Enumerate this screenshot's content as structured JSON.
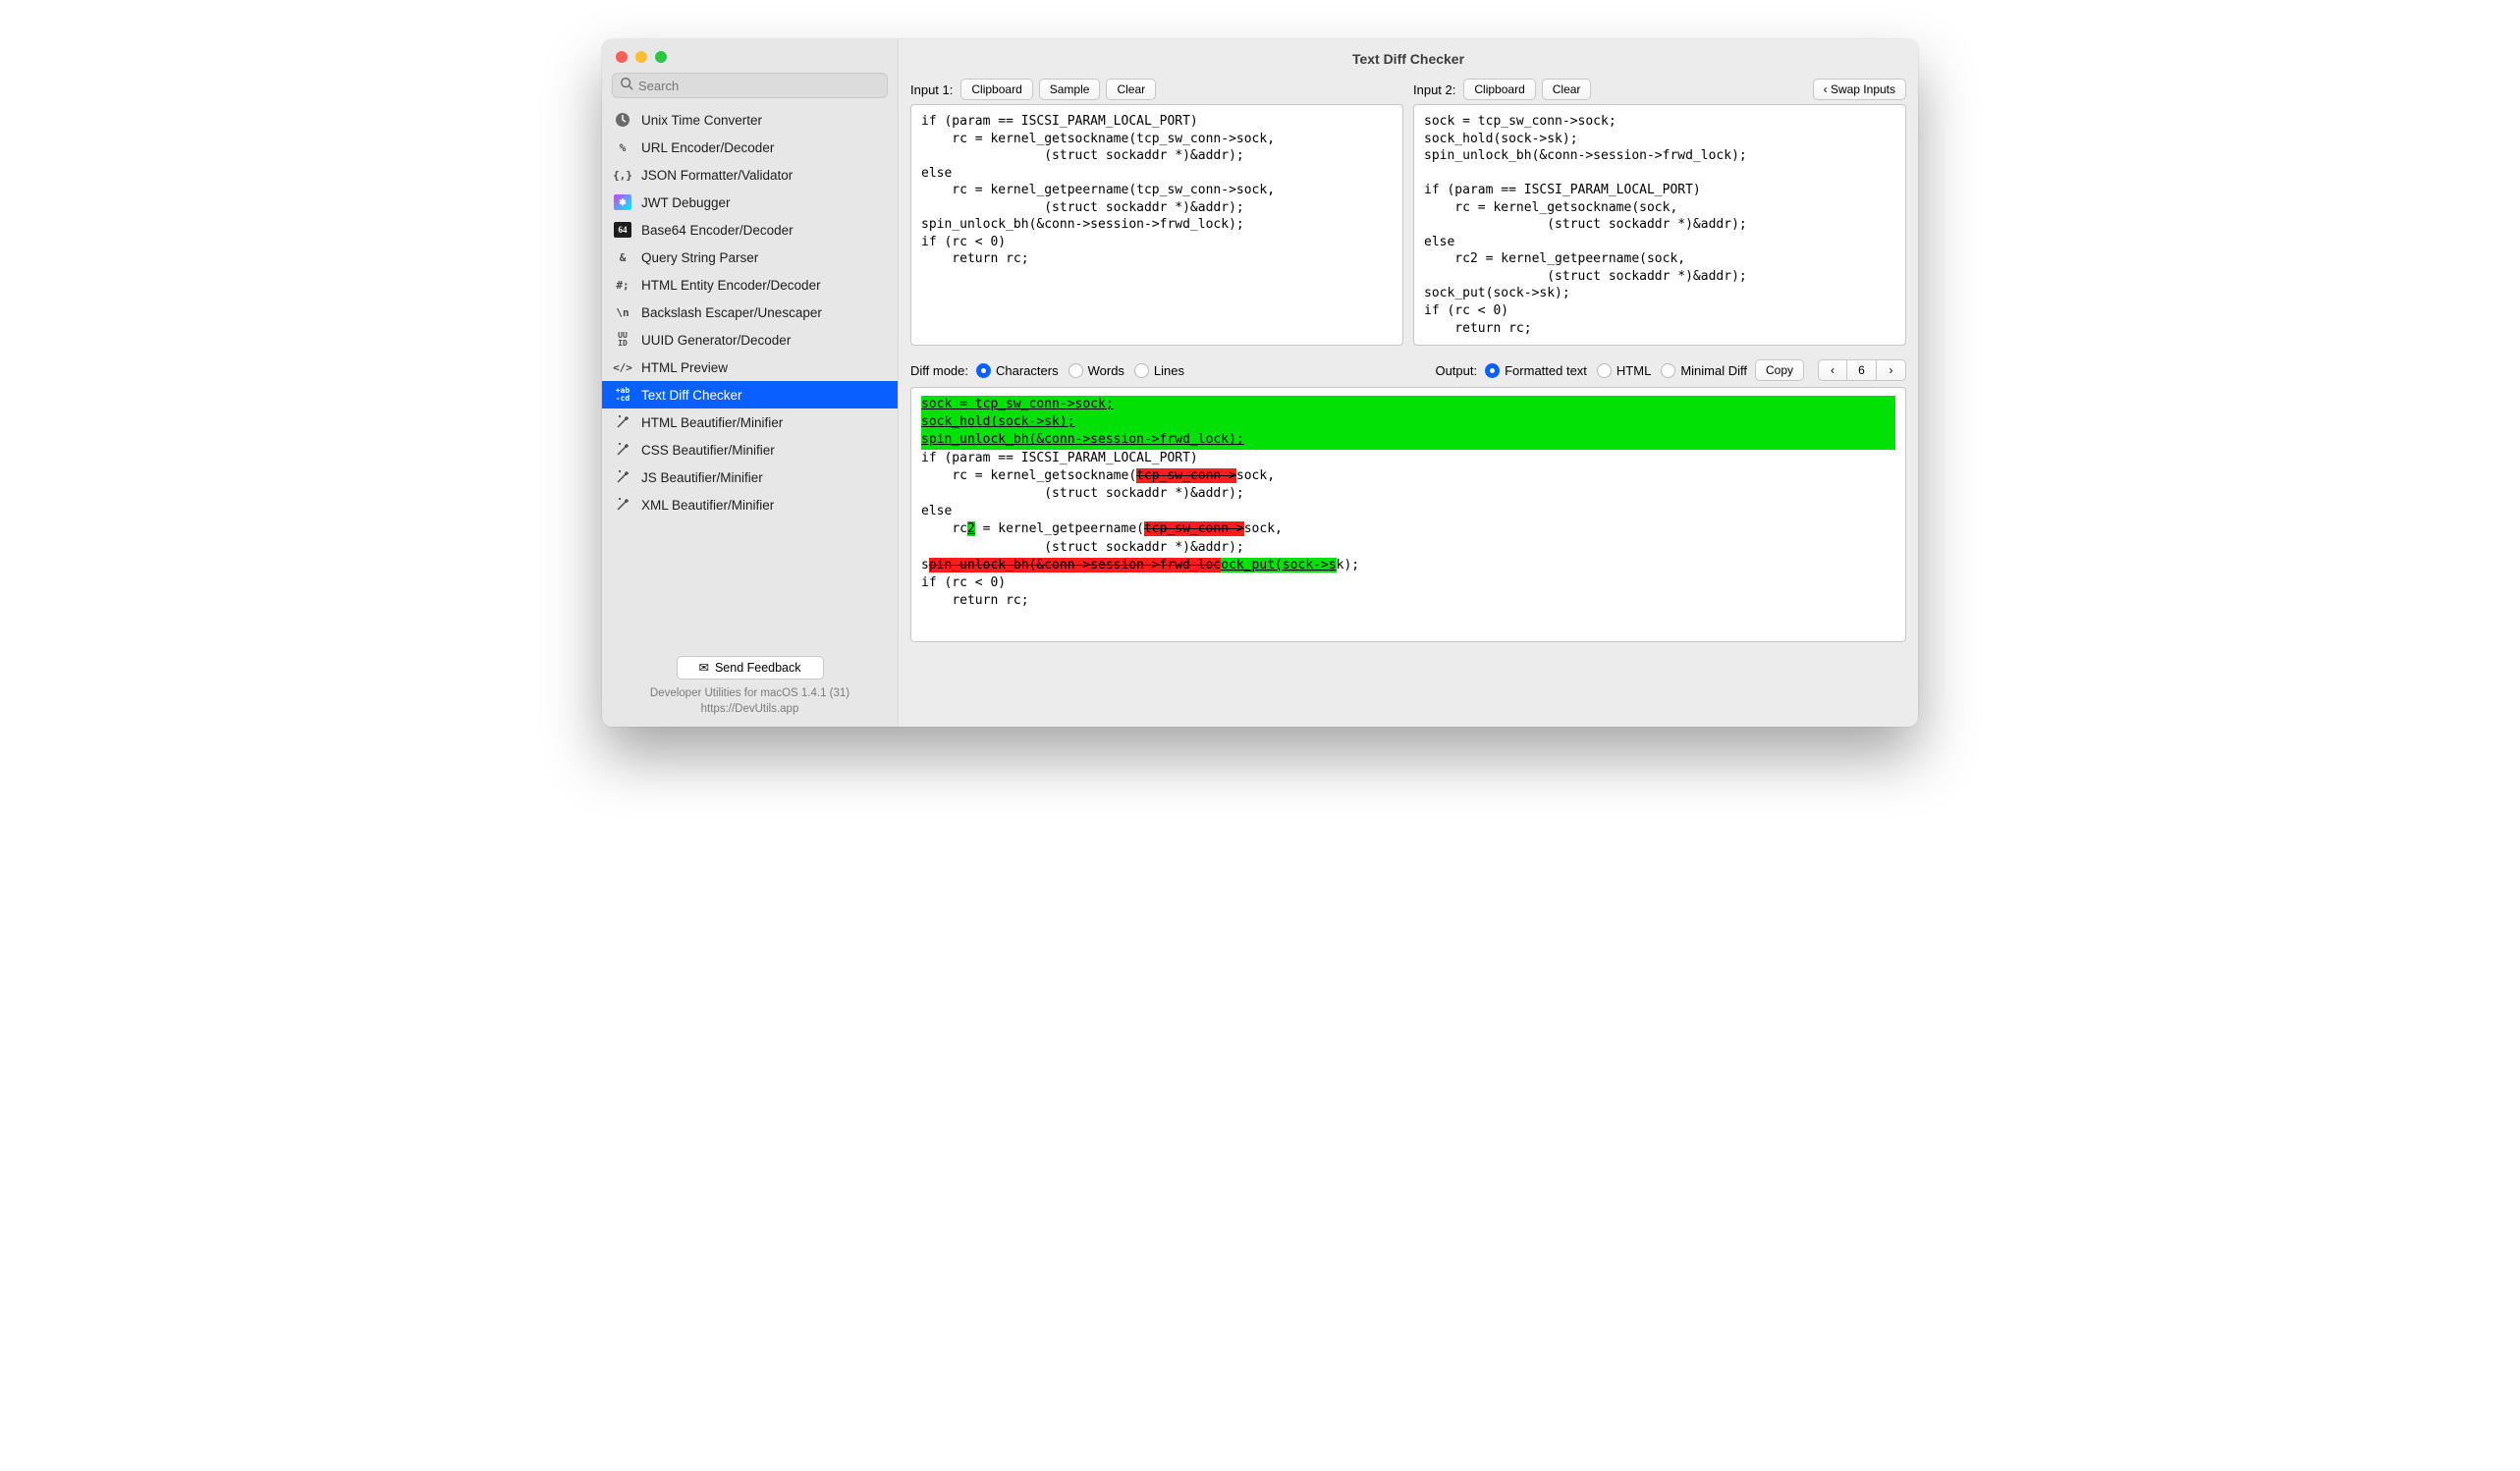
{
  "search": {
    "placeholder": "Search"
  },
  "sidebar": {
    "items": [
      {
        "icon": "clock",
        "label": "Unix Time Converter"
      },
      {
        "icon": "percent",
        "label": "URL Encoder/Decoder"
      },
      {
        "icon": "braces",
        "label": "JSON Formatter/Validator"
      },
      {
        "icon": "jwt",
        "label": "JWT Debugger"
      },
      {
        "icon": "b64",
        "label": "Base64 Encoder/Decoder"
      },
      {
        "icon": "amp",
        "label": "Query String Parser"
      },
      {
        "icon": "hash",
        "label": "HTML Entity Encoder/Decoder"
      },
      {
        "icon": "bslash",
        "label": "Backslash Escaper/Unescaper"
      },
      {
        "icon": "uuid",
        "label": "UUID Generator/Decoder"
      },
      {
        "icon": "tags",
        "label": "HTML Preview"
      },
      {
        "icon": "diff",
        "label": "Text Diff Checker",
        "active": true
      },
      {
        "icon": "wand",
        "label": "HTML Beautifier/Minifier"
      },
      {
        "icon": "wand",
        "label": "CSS Beautifier/Minifier"
      },
      {
        "icon": "wand",
        "label": "JS Beautifier/Minifier"
      },
      {
        "icon": "wand",
        "label": "XML Beautifier/Minifier"
      }
    ]
  },
  "feedback_label": "Send Feedback",
  "meta_line1": "Developer Utilities for macOS 1.4.1 (31)",
  "meta_line2": "https://DevUtils.app",
  "title": "Text Diff Checker",
  "input1": {
    "label": "Input 1:",
    "btn_clipboard": "Clipboard",
    "btn_sample": "Sample",
    "btn_clear": "Clear",
    "text": "if (param == ISCSI_PARAM_LOCAL_PORT)\n    rc = kernel_getsockname(tcp_sw_conn->sock,\n                (struct sockaddr *)&addr);\nelse\n    rc = kernel_getpeername(tcp_sw_conn->sock,\n                (struct sockaddr *)&addr);\nspin_unlock_bh(&conn->session->frwd_lock);\nif (rc < 0)\n    return rc;"
  },
  "input2": {
    "label": "Input 2:",
    "btn_clipboard": "Clipboard",
    "btn_clear": "Clear",
    "btn_swap": "Swap Inputs",
    "text": "sock = tcp_sw_conn->sock;\nsock_hold(sock->sk);\nspin_unlock_bh(&conn->session->frwd_lock);\n\nif (param == ISCSI_PARAM_LOCAL_PORT)\n    rc = kernel_getsockname(sock,\n                (struct sockaddr *)&addr);\nelse\n    rc2 = kernel_getpeername(sock,\n                (struct sockaddr *)&addr);\nsock_put(sock->sk);\nif (rc < 0)\n    return rc;"
  },
  "diffmode": {
    "label": "Diff mode:",
    "opts": [
      "Characters",
      "Words",
      "Lines"
    ],
    "selected": "Characters"
  },
  "output": {
    "label": "Output:",
    "opts": [
      "Formatted text",
      "HTML",
      "Minimal Diff"
    ],
    "selected": "Formatted text",
    "btn_copy": "Copy",
    "nav_count": "6"
  },
  "diff": {
    "ins_block": "sock = tcp_sw_conn->sock;\nsock_hold(sock->sk);\nspin_unlock_bh(&conn->session->frwd_lock);\n",
    "l2a": "if (param == ISCSI_PARAM_LOCAL_PORT)\n    rc = kernel_getsockname(",
    "del1": "tcp_sw_conn->",
    "l2b": "sock,\n                (struct sockaddr *)&addr);\nelse\n    rc",
    "ins2": "2",
    "l3a": " = kernel_getpeername(",
    "del2": "tcp_sw_conn->",
    "l3b": "sock,\n                (struct sockaddr *)&addr);\ns",
    "del3": "pin_unlock_bh(&conn->session->frwd_loc",
    "ins3": "ock_put(sock->s",
    "l4": "k);\nif (rc < 0)\n    return rc;"
  }
}
